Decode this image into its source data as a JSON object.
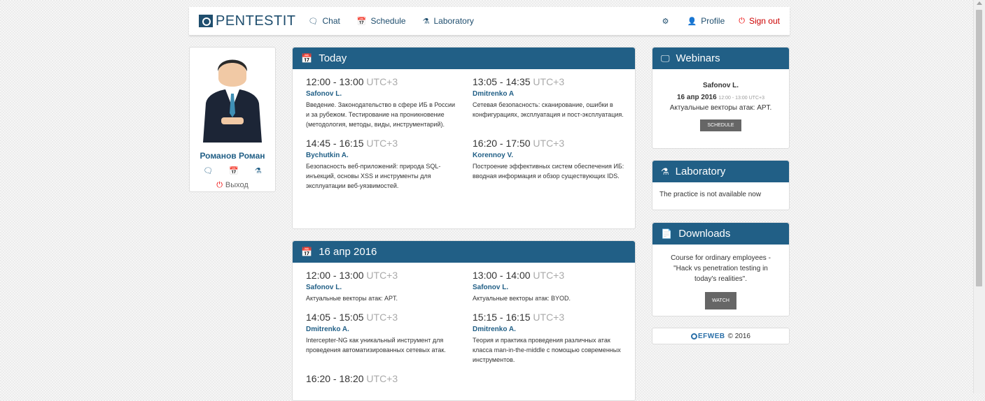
{
  "navbar": {
    "brand": "PENTESTIT",
    "links": [
      {
        "label": "Chat",
        "icon": "chat-icon"
      },
      {
        "label": "Schedule",
        "icon": "calendar-icon"
      },
      {
        "label": "Laboratory",
        "icon": "flask-icon"
      }
    ],
    "profile_label": "Profile",
    "signout_label": "Sign out"
  },
  "profile": {
    "name": "Романов Роман",
    "logout_label": "Выход"
  },
  "today": {
    "title": "Today",
    "slots": [
      {
        "time": "12:00 - 13:00",
        "tz": "UTC+3",
        "speaker": "Safonov L.",
        "desc": "Введение. Законодательство в сфере ИБ в России и за рубежом. Тестирование на проникновение (методология, методы, виды, инструментарий)."
      },
      {
        "time": "13:05 - 14:35",
        "tz": "UTC+3",
        "speaker": "Dmitrenko A",
        "desc": "Сетевая безопасность: сканирование, ошибки в конфигурациях, эксплуатация и пост-эксплуатация."
      },
      {
        "time": "14:45 - 16:15",
        "tz": "UTC+3",
        "speaker": "Bychutkin A.",
        "desc": "Безопасность веб-приложений: природа SQL-инъекций, основы XSS и инструменты для эксплуатации веб-уязвимостей."
      },
      {
        "time": "16:20 - 17:50",
        "tz": "UTC+3",
        "speaker": "Korennoy V.",
        "desc": "Построение эффективных систем обеспечения ИБ: вводная информация и обзор существующих IDS."
      }
    ]
  },
  "apr": {
    "title": "16 апр 2016",
    "slots": [
      {
        "time": "12:00 - 13:00",
        "tz": "UTC+3",
        "speaker": "Safonov L.",
        "desc": "Актуальные векторы атак: APT."
      },
      {
        "time": "13:00 - 14:00",
        "tz": "UTC+3",
        "speaker": "Safonov L.",
        "desc": "Актуальные векторы атак: BYOD."
      },
      {
        "time": "14:05 - 15:05",
        "tz": "UTC+3",
        "speaker": "Dmitrenko A.",
        "desc": "Intercepter-NG как уникальный инструмент для проведения автоматизированных сетевых атак."
      },
      {
        "time": "15:15 - 16:15",
        "tz": "UTC+3",
        "speaker": "Dmitrenko A.",
        "desc": "Теория и практика проведения различных атак класса man-in-the-middle с помощью современных инструментов."
      },
      {
        "time": "16:20 - 18:20",
        "tz": "UTC+3",
        "speaker": "",
        "desc": ""
      }
    ]
  },
  "webinars": {
    "title": "Webinars",
    "name": "Safonov L.",
    "date": "16 апр 2016",
    "time_small": "12:00 - 13:00 UTC+3",
    "topic": "Актуальные векторы атак: APT.",
    "button": "SCHEDULE"
  },
  "laboratory": {
    "title": "Laboratory",
    "text": "The practice is not available now"
  },
  "downloads": {
    "title": "Downloads",
    "text": "Course for ordinary employees - \"Hack vs penetration testing in today's realities\".",
    "button": "WATCH"
  },
  "footer": {
    "brand": "EFWEB",
    "copyright": "© 2016"
  },
  "colors": {
    "accent": "#215f86",
    "danger": "#e00000"
  }
}
